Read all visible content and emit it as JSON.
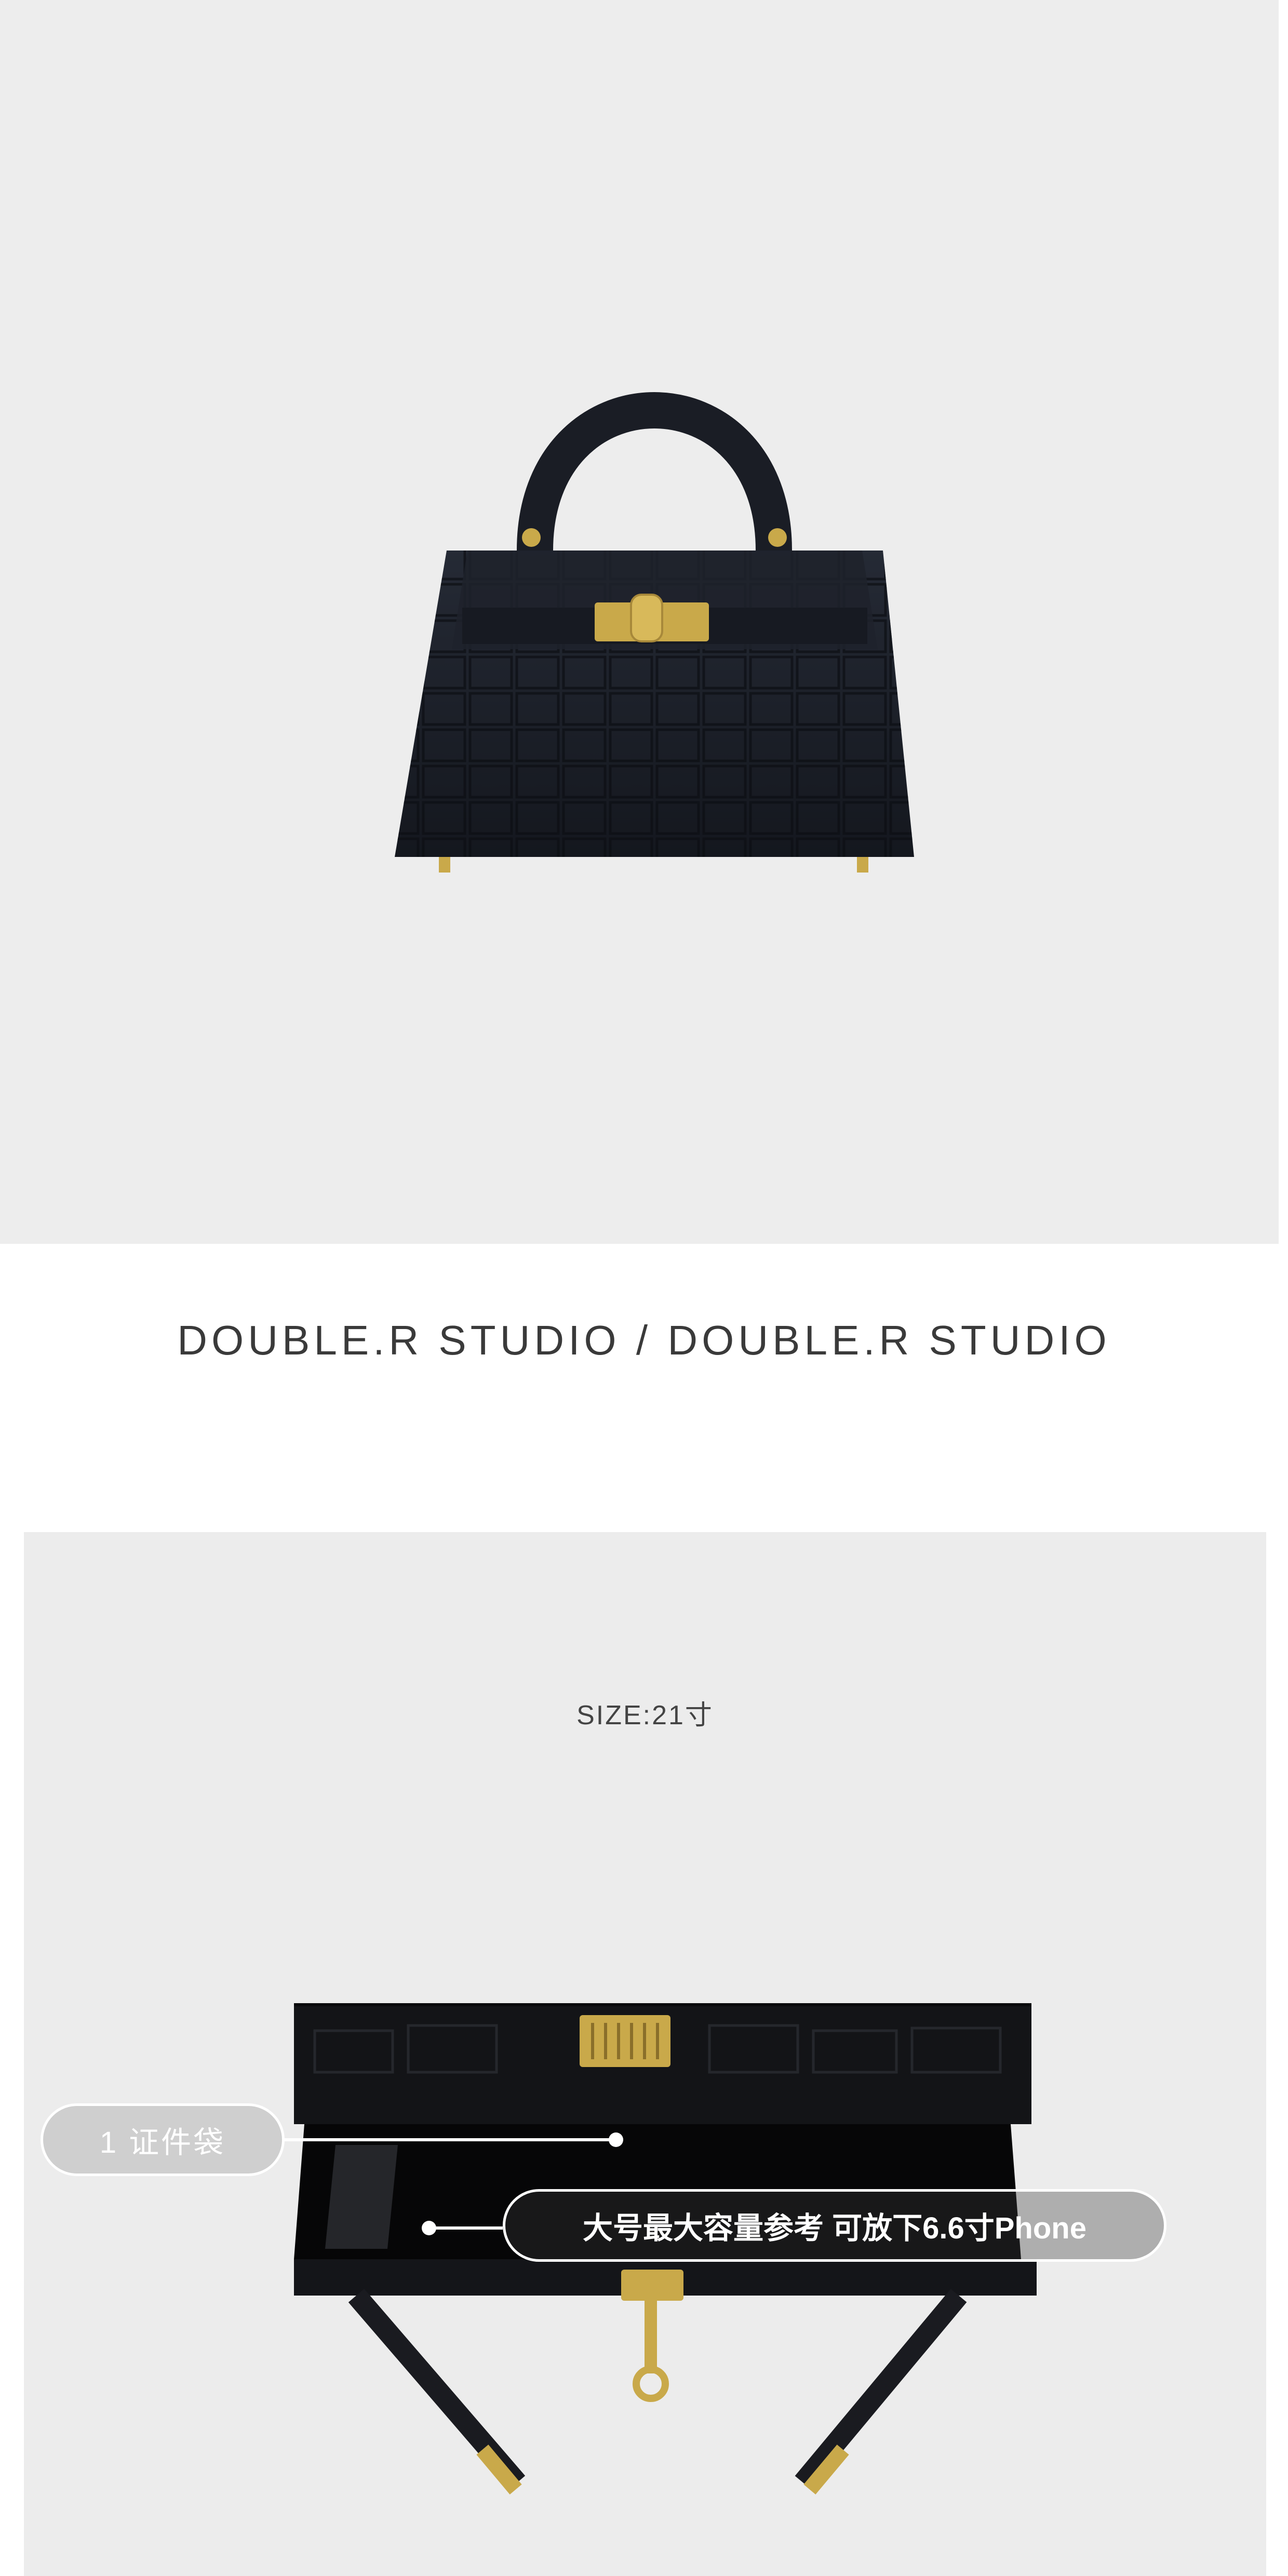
{
  "brand": {
    "text": "DOUBLE.R STUDIO / DOUBLE.R STUDIO"
  },
  "size": {
    "label": "SIZE:21寸"
  },
  "callouts": {
    "left": "1 证件袋",
    "right": "大号最大容量参考  可放下6.6寸Phone"
  },
  "colors": {
    "background": "#ededed",
    "bag": "#1b1e26",
    "hardware": "#c9a94a"
  }
}
